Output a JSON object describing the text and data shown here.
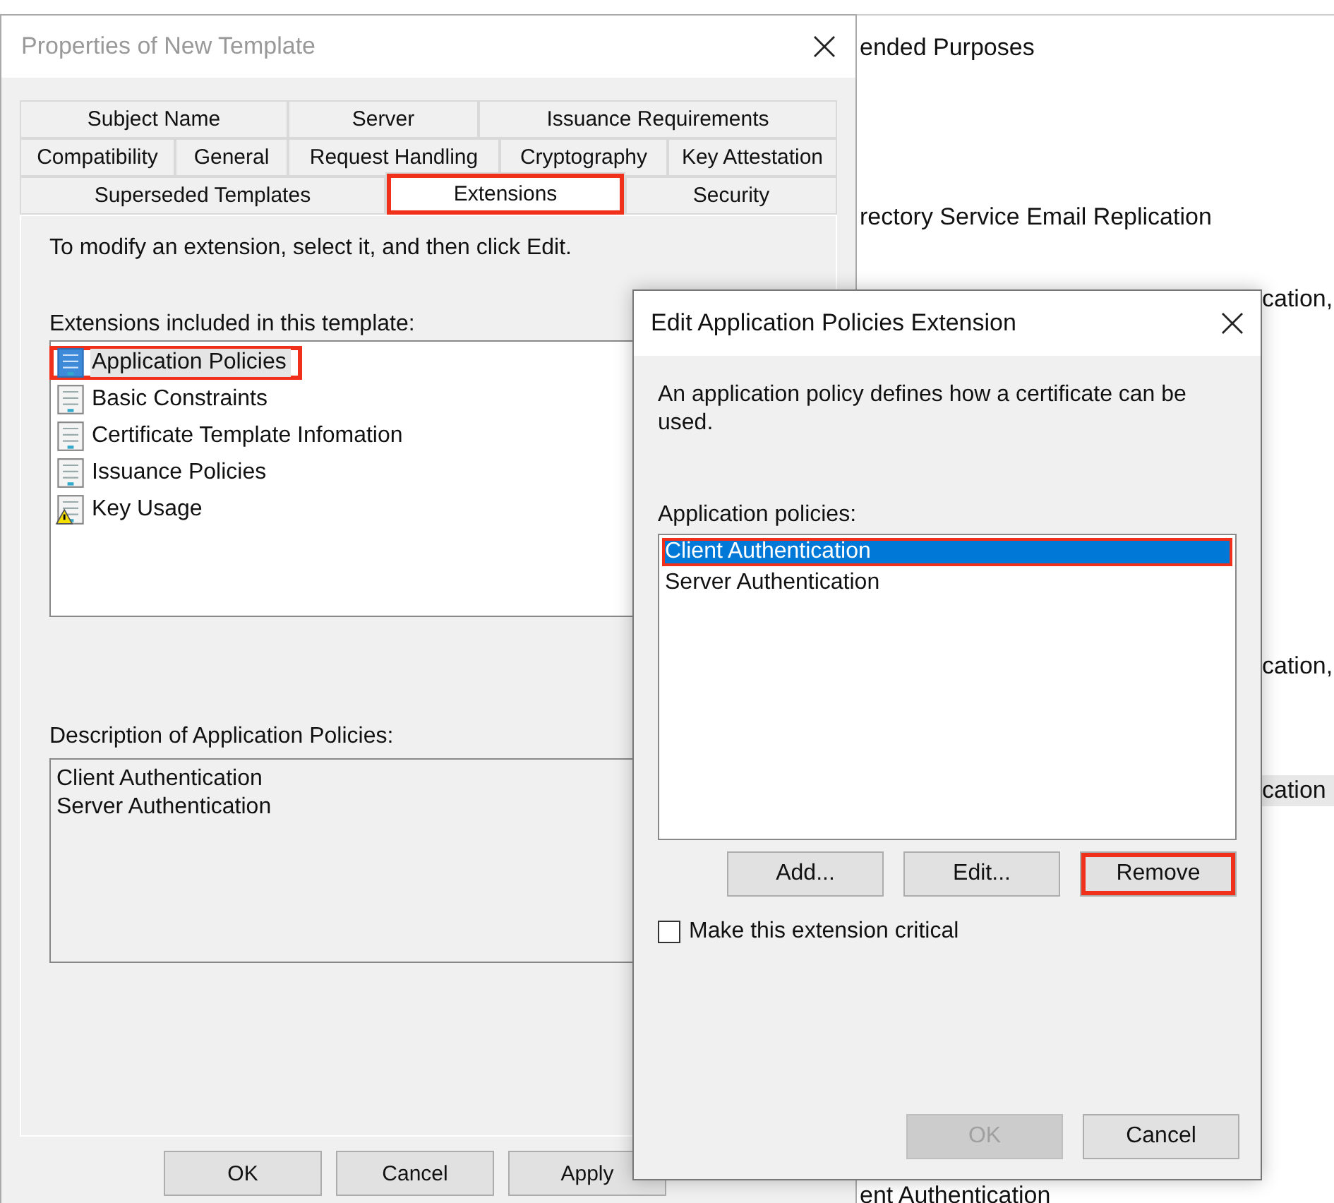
{
  "background_window": {
    "lines": [
      {
        "text": "ended Purposes",
        "selected": false
      },
      {
        "text": "rectory Service Email Replication",
        "selected": false
      },
      {
        "text": "cation,",
        "selected": false
      },
      {
        "text": "cation,",
        "selected": false
      },
      {
        "text": "cation",
        "selected": true
      },
      {
        "text": "ent Authentication",
        "selected": false
      }
    ]
  },
  "properties_dialog": {
    "title": "Properties of New Template",
    "tab_rows": [
      [
        {
          "label": "Subject Name",
          "selected": false,
          "highlighted": false
        },
        {
          "label": "Server",
          "selected": false,
          "highlighted": false
        },
        {
          "label": "Issuance Requirements",
          "selected": false,
          "highlighted": false
        }
      ],
      [
        {
          "label": "Compatibility",
          "selected": false,
          "highlighted": false
        },
        {
          "label": "General",
          "selected": false,
          "highlighted": false
        },
        {
          "label": "Request Handling",
          "selected": false,
          "highlighted": false
        },
        {
          "label": "Cryptography",
          "selected": false,
          "highlighted": false
        },
        {
          "label": "Key Attestation",
          "selected": false,
          "highlighted": false
        }
      ],
      [
        {
          "label": "Superseded Templates",
          "selected": false,
          "highlighted": false
        },
        {
          "label": "Extensions",
          "selected": true,
          "highlighted": true
        },
        {
          "label": "Security",
          "selected": false,
          "highlighted": false
        }
      ]
    ],
    "instruction": "To modify an extension, select it, and then click Edit.",
    "extensions_label": "Extensions included in this template:",
    "extensions": [
      {
        "label": "Application Policies",
        "kind": "normal",
        "selected": true,
        "highlighted": true
      },
      {
        "label": "Basic Constraints",
        "kind": "normal",
        "selected": false,
        "highlighted": false
      },
      {
        "label": "Certificate Template Infomation",
        "kind": "normal",
        "selected": false,
        "highlighted": false
      },
      {
        "label": "Issuance Policies",
        "kind": "normal",
        "selected": false,
        "highlighted": false
      },
      {
        "label": "Key Usage",
        "kind": "warning",
        "selected": false,
        "highlighted": false
      }
    ],
    "description_label": "Description of Application Policies:",
    "description_lines": [
      "Client Authentication",
      "Server Authentication"
    ],
    "buttons": [
      "OK",
      "Cancel",
      "Apply"
    ]
  },
  "edit_dialog": {
    "title": "Edit Application Policies Extension",
    "description": "An application policy defines how a certificate can be used.",
    "policies_label": "Application policies:",
    "policies": [
      {
        "label": "Client Authentication",
        "selected": true,
        "highlighted": true
      },
      {
        "label": "Server Authentication",
        "selected": false,
        "highlighted": false
      }
    ],
    "list_buttons": [
      {
        "label": "Add...",
        "highlighted": false
      },
      {
        "label": "Edit...",
        "highlighted": false
      },
      {
        "label": "Remove",
        "highlighted": true
      }
    ],
    "critical": {
      "label": "Make this extension critical",
      "checked": false
    },
    "buttons": [
      {
        "label": "OK",
        "disabled": true
      },
      {
        "label": "Cancel",
        "disabled": false
      }
    ]
  }
}
